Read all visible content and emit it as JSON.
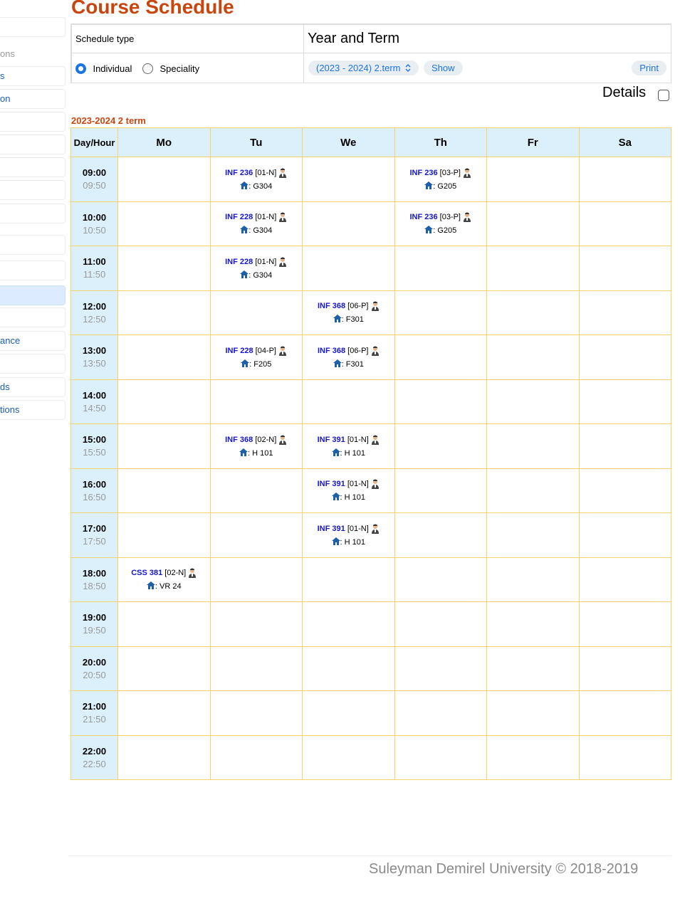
{
  "sidebar": {
    "items": [
      {
        "label": "",
        "style": "box"
      },
      {
        "label": "ons",
        "style": "gray"
      },
      {
        "label": "s",
        "style": "box"
      },
      {
        "label": "on",
        "style": "box"
      },
      {
        "label": "",
        "style": "box"
      },
      {
        "label": "",
        "style": "box"
      },
      {
        "label": "",
        "style": "box"
      },
      {
        "label": "",
        "style": "box"
      },
      {
        "label": "",
        "style": "box"
      },
      {
        "label": "",
        "style": "box"
      },
      {
        "label": "",
        "style": "box"
      },
      {
        "label": "",
        "style": "active"
      },
      {
        "label": "",
        "style": "box"
      },
      {
        "label": "ance",
        "style": "box"
      },
      {
        "label": "",
        "style": "box"
      },
      {
        "label": "ds",
        "style": "box"
      },
      {
        "label": "tions",
        "style": "box"
      }
    ]
  },
  "page": {
    "title": "Course Schedule",
    "footer": "Suleyman Demirel University © 2018-2019"
  },
  "controls": {
    "schedule_type_label": "Schedule type",
    "year_term_label": "Year and Term",
    "individual_label": "Individual",
    "speciality_label": "Speciality",
    "selected_schedule_type": "Individual",
    "term_select_value": "(2023 - 2024) 2.term",
    "show_label": "Show",
    "print_label": "Print",
    "details_label": "Details",
    "details_checked": false
  },
  "schedule": {
    "term_heading": "2023-2024 2 term",
    "day_hour_label": "Day/Hour",
    "days": [
      "Mo",
      "Tu",
      "We",
      "Th",
      "Fr",
      "Sa"
    ],
    "slots": [
      {
        "start": "09:00",
        "end": "09:50",
        "cells": [
          null,
          {
            "code": "INF 236",
            "group": "[01-N]",
            "room": ": G304"
          },
          null,
          {
            "code": "INF 236",
            "group": "[03-P]",
            "room": ": G205"
          },
          null,
          null
        ]
      },
      {
        "start": "10:00",
        "end": "10:50",
        "cells": [
          null,
          {
            "code": "INF 228",
            "group": "[01-N]",
            "room": ": G304"
          },
          null,
          {
            "code": "INF 236",
            "group": "[03-P]",
            "room": ": G205"
          },
          null,
          null
        ]
      },
      {
        "start": "11:00",
        "end": "11:50",
        "cells": [
          null,
          {
            "code": "INF 228",
            "group": "[01-N]",
            "room": ": G304"
          },
          null,
          null,
          null,
          null
        ]
      },
      {
        "start": "12:00",
        "end": "12:50",
        "cells": [
          null,
          null,
          {
            "code": "INF 368",
            "group": "[06-P]",
            "room": ": F301"
          },
          null,
          null,
          null
        ]
      },
      {
        "start": "13:00",
        "end": "13:50",
        "cells": [
          null,
          {
            "code": "INF 228",
            "group": "[04-P]",
            "room": ": F205"
          },
          {
            "code": "INF 368",
            "group": "[06-P]",
            "room": ": F301"
          },
          null,
          null,
          null
        ]
      },
      {
        "start": "14:00",
        "end": "14:50",
        "cells": [
          null,
          null,
          null,
          null,
          null,
          null
        ]
      },
      {
        "start": "15:00",
        "end": "15:50",
        "cells": [
          null,
          {
            "code": "INF 368",
            "group": "[02-N]",
            "room": ": H 101"
          },
          {
            "code": "INF 391",
            "group": "[01-N]",
            "room": ": H 101"
          },
          null,
          null,
          null
        ]
      },
      {
        "start": "16:00",
        "end": "16:50",
        "cells": [
          null,
          null,
          {
            "code": "INF 391",
            "group": "[01-N]",
            "room": ": H 101"
          },
          null,
          null,
          null
        ]
      },
      {
        "start": "17:00",
        "end": "17:50",
        "cells": [
          null,
          null,
          {
            "code": "INF 391",
            "group": "[01-N]",
            "room": ": H 101"
          },
          null,
          null,
          null
        ]
      },
      {
        "start": "18:00",
        "end": "18:50",
        "cells": [
          {
            "code": "CSS 381",
            "group": "[02-N]",
            "room": ": VR 24"
          },
          null,
          null,
          null,
          null,
          null
        ]
      },
      {
        "start": "19:00",
        "end": "19:50",
        "cells": [
          null,
          null,
          null,
          null,
          null,
          null
        ]
      },
      {
        "start": "20:00",
        "end": "20:50",
        "cells": [
          null,
          null,
          null,
          null,
          null,
          null
        ]
      },
      {
        "start": "21:00",
        "end": "21:50",
        "cells": [
          null,
          null,
          null,
          null,
          null,
          null
        ]
      },
      {
        "start": "22:00",
        "end": "22:50",
        "cells": [
          null,
          null,
          null,
          null,
          null,
          null
        ]
      }
    ]
  },
  "icons": {
    "teacher": "teacher-icon",
    "room": "home-icon",
    "dropdown": "chevron-updown-icon"
  },
  "colors": {
    "title": "#c8460e",
    "course_code": "#1515d6",
    "header_bg": "#dcf0fb",
    "grid_border": "#f5d36a",
    "accent": "#1a73e8"
  }
}
